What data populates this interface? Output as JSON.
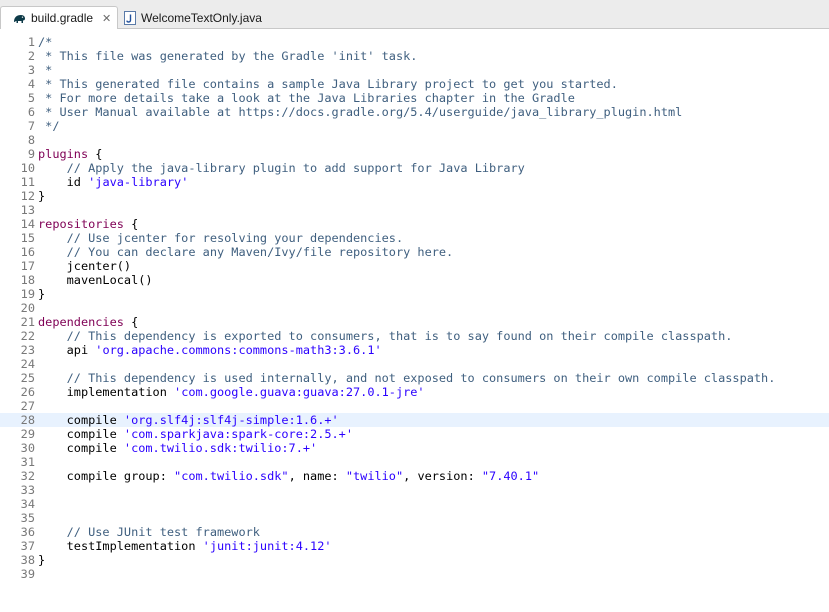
{
  "tabs": [
    {
      "label": "build.gradle",
      "icon": "gradle-elephant-icon",
      "active": true,
      "close": "✕"
    },
    {
      "label": "WelcomeTextOnly.java",
      "icon": "java-file-icon",
      "active": false
    }
  ],
  "editor": {
    "current_line": 28,
    "lines": [
      {
        "n": "1",
        "tokens": [
          {
            "t": "/*",
            "c": "comment"
          }
        ]
      },
      {
        "n": "2",
        "tokens": [
          {
            "t": " * This file was generated by the Gradle 'init' task.",
            "c": "comment"
          }
        ]
      },
      {
        "n": "3",
        "tokens": [
          {
            "t": " *",
            "c": "comment"
          }
        ]
      },
      {
        "n": "4",
        "tokens": [
          {
            "t": " * This generated file contains a sample Java Library project to get you started.",
            "c": "comment"
          }
        ]
      },
      {
        "n": "5",
        "tokens": [
          {
            "t": " * For more details take a look at the Java Libraries chapter in the Gradle",
            "c": "comment"
          }
        ]
      },
      {
        "n": "6",
        "tokens": [
          {
            "t": " * User Manual available at https://docs.gradle.org/5.4/userguide/java_library_plugin.html",
            "c": "comment"
          }
        ]
      },
      {
        "n": "7",
        "tokens": [
          {
            "t": " */",
            "c": "comment"
          }
        ]
      },
      {
        "n": "8",
        "tokens": []
      },
      {
        "n": "9",
        "tokens": [
          {
            "t": "plugins",
            "c": "kw"
          },
          {
            "t": " {",
            "c": "plain"
          }
        ]
      },
      {
        "n": "10",
        "tokens": [
          {
            "t": "    ",
            "c": "plain"
          },
          {
            "t": "// Apply the java-library plugin to add support for Java Library",
            "c": "comment"
          }
        ]
      },
      {
        "n": "11",
        "tokens": [
          {
            "t": "    id ",
            "c": "plain"
          },
          {
            "t": "'java-library'",
            "c": "str"
          }
        ]
      },
      {
        "n": "12",
        "tokens": [
          {
            "t": "}",
            "c": "plain"
          }
        ]
      },
      {
        "n": "13",
        "tokens": []
      },
      {
        "n": "14",
        "tokens": [
          {
            "t": "repositories",
            "c": "kw"
          },
          {
            "t": " {",
            "c": "plain"
          }
        ]
      },
      {
        "n": "15",
        "tokens": [
          {
            "t": "    ",
            "c": "plain"
          },
          {
            "t": "// Use jcenter for resolving your dependencies.",
            "c": "comment"
          }
        ]
      },
      {
        "n": "16",
        "tokens": [
          {
            "t": "    ",
            "c": "plain"
          },
          {
            "t": "// You can declare any Maven/Ivy/file repository here.",
            "c": "comment"
          }
        ]
      },
      {
        "n": "17",
        "tokens": [
          {
            "t": "    jcenter()",
            "c": "plain"
          }
        ]
      },
      {
        "n": "18",
        "tokens": [
          {
            "t": "    mavenLocal()",
            "c": "plain"
          }
        ]
      },
      {
        "n": "19",
        "tokens": [
          {
            "t": "}",
            "c": "plain"
          }
        ]
      },
      {
        "n": "20",
        "tokens": []
      },
      {
        "n": "21",
        "tokens": [
          {
            "t": "dependencies",
            "c": "kw"
          },
          {
            "t": " {",
            "c": "plain"
          }
        ]
      },
      {
        "n": "22",
        "tokens": [
          {
            "t": "    ",
            "c": "plain"
          },
          {
            "t": "// This dependency is exported to consumers, that is to say found on their compile classpath.",
            "c": "comment"
          }
        ]
      },
      {
        "n": "23",
        "tokens": [
          {
            "t": "    api ",
            "c": "plain"
          },
          {
            "t": "'org.apache.commons:commons-math3:3.6.1'",
            "c": "str"
          }
        ]
      },
      {
        "n": "24",
        "tokens": []
      },
      {
        "n": "25",
        "tokens": [
          {
            "t": "    ",
            "c": "plain"
          },
          {
            "t": "// This dependency is used internally, and not exposed to consumers on their own compile classpath.",
            "c": "comment"
          }
        ]
      },
      {
        "n": "26",
        "tokens": [
          {
            "t": "    implementation ",
            "c": "plain"
          },
          {
            "t": "'com.google.guava:guava:27.0.1-jre'",
            "c": "str"
          }
        ]
      },
      {
        "n": "27",
        "tokens": []
      },
      {
        "n": "28",
        "tokens": [
          {
            "t": "    compile ",
            "c": "plain"
          },
          {
            "t": "'org.slf4j:slf4j-simple:1.6.+'",
            "c": "str"
          }
        ]
      },
      {
        "n": "29",
        "tokens": [
          {
            "t": "    compile ",
            "c": "plain"
          },
          {
            "t": "'com.sparkjava:spark-core:2.5.+'",
            "c": "str"
          }
        ]
      },
      {
        "n": "30",
        "tokens": [
          {
            "t": "    compile ",
            "c": "plain"
          },
          {
            "t": "'com.twilio.sdk:twilio:7.+'",
            "c": "str"
          }
        ]
      },
      {
        "n": "31",
        "tokens": []
      },
      {
        "n": "32",
        "tokens": [
          {
            "t": "    compile group: ",
            "c": "plain"
          },
          {
            "t": "\"com.twilio.sdk\"",
            "c": "str"
          },
          {
            "t": ", name: ",
            "c": "plain"
          },
          {
            "t": "\"twilio\"",
            "c": "str"
          },
          {
            "t": ", version: ",
            "c": "plain"
          },
          {
            "t": "\"7.40.1\"",
            "c": "str"
          }
        ]
      },
      {
        "n": "33",
        "tokens": []
      },
      {
        "n": "34",
        "tokens": []
      },
      {
        "n": "35",
        "tokens": []
      },
      {
        "n": "36",
        "tokens": [
          {
            "t": "    ",
            "c": "plain"
          },
          {
            "t": "// Use JUnit test framework",
            "c": "comment"
          }
        ]
      },
      {
        "n": "37",
        "tokens": [
          {
            "t": "    testImplementation ",
            "c": "plain"
          },
          {
            "t": "'junit:junit:4.12'",
            "c": "str"
          }
        ]
      },
      {
        "n": "38",
        "tokens": [
          {
            "t": "}",
            "c": "plain"
          }
        ]
      },
      {
        "n": "39",
        "tokens": []
      }
    ]
  },
  "colors": {
    "comment": "#3f5f7f",
    "keyword": "#7f0055",
    "string": "#2a00ff",
    "current_line_bg": "#e8f2fe",
    "line_number": "#787878"
  }
}
